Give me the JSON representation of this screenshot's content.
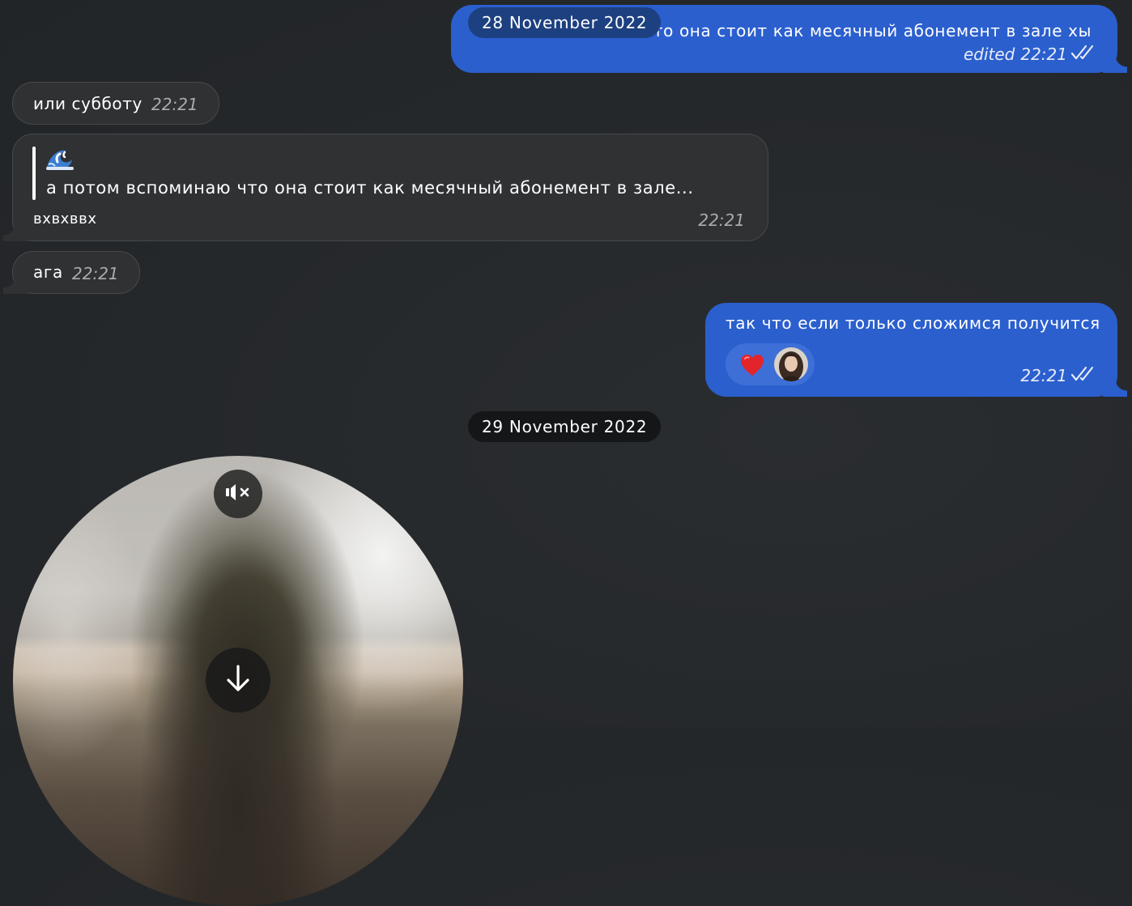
{
  "messages": {
    "m1": {
      "text": "то она стоит как месячный абонемент в зале хы",
      "edited_label": "edited",
      "time": "22:21",
      "status": "read"
    },
    "m2": {
      "text": "или субботу",
      "time": "22:21"
    },
    "m3": {
      "reply": {
        "emoji": "🌊",
        "text": "а потом вспоминаю что она стоит как месячный абонемент в зале..."
      },
      "text": "вхвхввх",
      "time": "22:21"
    },
    "m4": {
      "text": "ага",
      "time": "22:21"
    },
    "m5": {
      "text": "так что если только сложимся получится",
      "reactions": [
        {
          "emoji": "❤️",
          "icon": "heart-icon"
        }
      ],
      "time": "22:21",
      "status": "read"
    }
  },
  "dates": {
    "d1": "28 November 2022",
    "d2": "29 November 2022"
  },
  "video_note": {
    "controls": [
      "mute-icon",
      "download-arrow-icon"
    ]
  },
  "colors": {
    "outgoing_bubble": "#2b5fce",
    "incoming_bubble": "#2f3133",
    "background": "#25282b",
    "date_pill_dark": "#141618"
  }
}
